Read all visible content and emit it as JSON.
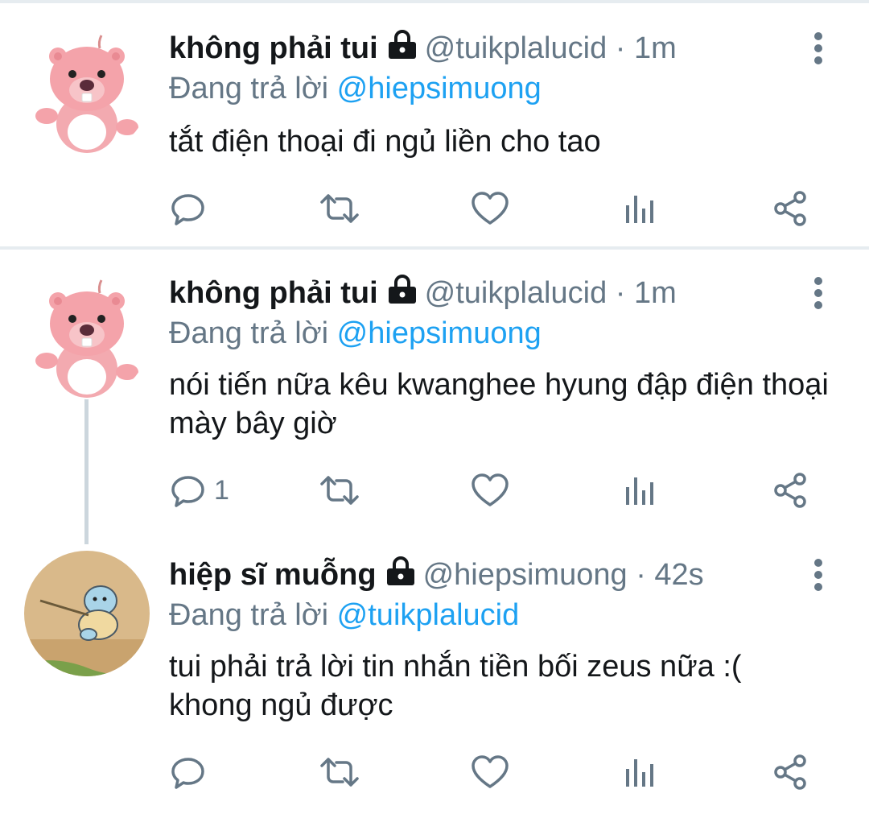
{
  "colors": {
    "text": "#14171a",
    "secondary": "#657786",
    "link": "#1da1f2",
    "divider": "#e6ecf0"
  },
  "tweets": [
    {
      "name": "không phải tui",
      "handle": "@tuikplalucid",
      "time": "· 1m",
      "reply_prefix": "Đang trả lời",
      "reply_to": "@hiepsimuong",
      "text": "tắt điện thoại đi ngủ liền cho tao",
      "reply_count": "",
      "avatar_icon": "pink-beaver-avatar",
      "locked": true
    },
    {
      "name": "không phải tui",
      "handle": "@tuikplalucid",
      "time": "· 1m",
      "reply_prefix": "Đang trả lời",
      "reply_to": "@hiepsimuong",
      "text": "nói tiến nữa kêu kwanghee hyung đập điện thoại mày bây giờ",
      "reply_count": "1",
      "avatar_icon": "pink-beaver-avatar",
      "locked": true
    },
    {
      "name": "hiệp sĩ muỗng",
      "handle": "@hiepsimuong",
      "time": "· 42s",
      "reply_prefix": "Đang trả lời",
      "reply_to": "@tuikplalucid",
      "text": "tui phải trả lời tin nhắn tiền bối zeus nữa :( khong ngủ được",
      "reply_count": "",
      "avatar_icon": "turtle-drawing-avatar",
      "locked": true
    }
  ],
  "action_icons": [
    "reply-icon",
    "retweet-icon",
    "like-icon",
    "analytics-icon",
    "share-icon"
  ]
}
